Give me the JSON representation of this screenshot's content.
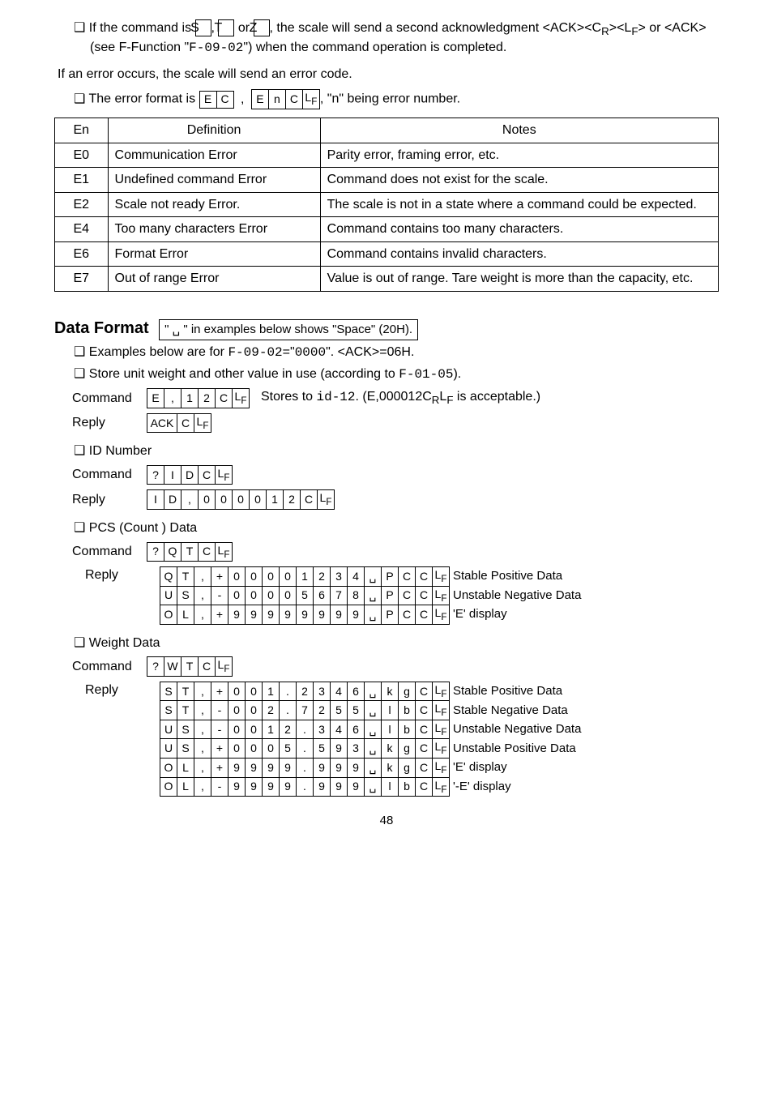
{
  "intro": {
    "bullet1_pre": "If the command is ",
    "keyS": "S",
    "keyT": "T",
    "keyZ": "Z",
    "bullet1_post": ", the scale will send a second acknowledgment <ACK><C",
    "bullet1_post2": "><L",
    "bullet1_post3": "> or <ACK> (see F-Function \"",
    "ffunc": "F-09-02",
    "bullet1_post4": "\") when the command operation is completed.",
    "err_sentence": "If an error occurs, the scale will send an error code.",
    "bullet2_pre": "The error format is ",
    "bullet2_post": ", \"n\" being error number."
  },
  "err_frame1": [
    "E",
    "C"
  ],
  "err_comma": ",",
  "err_frame2": [
    "E",
    "n",
    "C",
    "L"
  ],
  "errtable": {
    "h1": "En",
    "h2": "Definition",
    "h3": "Notes",
    "rows": [
      {
        "c": "E0",
        "d": "Communication Error",
        "n": "Parity error, framing error, etc."
      },
      {
        "c": "E1",
        "d": "Undefined command Error",
        "n": "Command does not exist for the scale."
      },
      {
        "c": "E2",
        "d": "Scale not ready Error.",
        "n": "The scale is not in a state where a command could be expected."
      },
      {
        "c": "E4",
        "d": "Too many characters Error",
        "n": "Command contains too many characters."
      },
      {
        "c": "E6",
        "d": "Format Error",
        "n": "Command contains invalid characters."
      },
      {
        "c": "E7",
        "d": "Out of range Error",
        "n": "Value is out of range. Tare weight is more than the capacity, etc."
      }
    ]
  },
  "dataformat": {
    "title": "Data Format",
    "note": "\" ␣ \"  in examples below shows \"Space\" (20H).",
    "ex_line_pre": "Examples below are for ",
    "ex_ff": "F-09-02",
    "ex_line_mid": "=\"",
    "ex_zeros": "0000",
    "ex_line_post": "\". <ACK>=06H.",
    "store_line_pre": "Store unit weight and other value in use (according to ",
    "store_ff": "F-01-05",
    "store_line_post": ").",
    "cmd_label": "Command",
    "rep_label": "Reply",
    "store_cmd": [
      "E",
      ",",
      "1",
      "2",
      "C",
      "L"
    ],
    "store_cmd_note_pre": "Stores to ",
    "store_cmd_id": "id-12",
    "store_cmd_note_post1": ". (E,000012C",
    "store_cmd_note_post2": "L",
    "store_cmd_note_post3": " is acceptable.)",
    "store_reply": [
      "ACK",
      "C",
      "L"
    ]
  },
  "idnum": {
    "title": "ID Number",
    "cmd": [
      "?",
      "I",
      "D",
      "C",
      "L"
    ],
    "reply": [
      "I",
      "D",
      ",",
      "0",
      "0",
      "0",
      "0",
      "1",
      "2",
      "C",
      "L"
    ]
  },
  "pcs": {
    "title": "PCS (Count ) Data",
    "cmd": [
      "?",
      "Q",
      "T",
      "C",
      "L"
    ],
    "rows": [
      {
        "cells": [
          "Q",
          "T",
          ",",
          "+",
          "0",
          "0",
          "0",
          "0",
          "1",
          "2",
          "3",
          "4",
          "␣",
          "P",
          "C",
          "C",
          "L"
        ],
        "desc": "Stable Positive Data"
      },
      {
        "cells": [
          "U",
          "S",
          ",",
          "-",
          "0",
          "0",
          "0",
          "0",
          "5",
          "6",
          "7",
          "8",
          "␣",
          "P",
          "C",
          "C",
          "L"
        ],
        "desc": "Unstable Negative Data"
      },
      {
        "cells": [
          "O",
          "L",
          ",",
          "+",
          "9",
          "9",
          "9",
          "9",
          "9",
          "9",
          "9",
          "9",
          "␣",
          "P",
          "C",
          "C",
          "L"
        ],
        "desc": "'E' display"
      }
    ]
  },
  "weight": {
    "title": "Weight Data",
    "cmd": [
      "?",
      "W",
      "T",
      "C",
      "L"
    ],
    "rows": [
      {
        "cells": [
          "S",
          "T",
          ",",
          "+",
          "0",
          "0",
          "1",
          ".",
          "2",
          "3",
          "4",
          "6",
          "␣",
          "k",
          "g",
          "C",
          "L"
        ],
        "desc": "Stable Positive Data"
      },
      {
        "cells": [
          "S",
          "T",
          ",",
          "-",
          "0",
          "0",
          "2",
          ".",
          "7",
          "2",
          "5",
          "5",
          "␣",
          "l",
          "b",
          "C",
          "L"
        ],
        "desc": "Stable Negative Data"
      },
      {
        "cells": [
          "U",
          "S",
          ",",
          "-",
          "0",
          "0",
          "1",
          "2",
          ".",
          "3",
          "4",
          "6",
          "␣",
          "l",
          "b",
          "C",
          "L"
        ],
        "desc": "Unstable Negative Data"
      },
      {
        "cells": [
          "U",
          "S",
          ",",
          "+",
          "0",
          "0",
          "0",
          "5",
          ".",
          "5",
          "9",
          "3",
          "␣",
          "k",
          "g",
          "C",
          "L"
        ],
        "desc": "Unstable Positive Data"
      },
      {
        "cells": [
          "O",
          "L",
          ",",
          "+",
          "9",
          "9",
          "9",
          "9",
          ".",
          "9",
          "9",
          "9",
          "␣",
          "k",
          "g",
          "C",
          "L"
        ],
        "desc": "'E' display"
      },
      {
        "cells": [
          "O",
          "L",
          ",",
          "-",
          "9",
          "9",
          "9",
          "9",
          ".",
          "9",
          "9",
          "9",
          "␣",
          "l",
          "b",
          "C",
          "L"
        ],
        "desc": "'-E' display"
      }
    ]
  },
  "pagenum": "48"
}
